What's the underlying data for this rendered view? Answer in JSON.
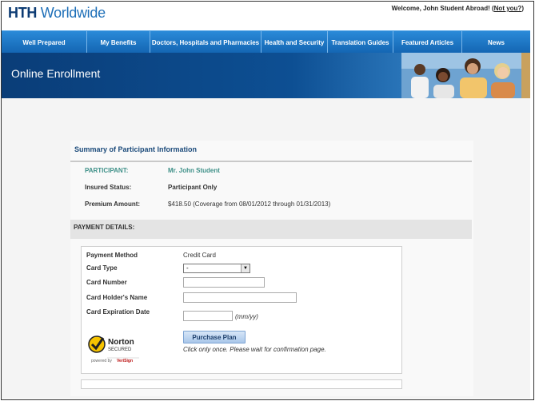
{
  "header": {
    "logo_bold": "HTH",
    "logo_light": "Worldwide",
    "welcome_text": "Welcome, John Student Abroad! (",
    "not_you_link": "Not you?",
    "welcome_close": ")"
  },
  "nav": {
    "items": [
      {
        "label": "Well Prepared"
      },
      {
        "label": "My Benefits"
      },
      {
        "label": "Doctors, Hospitals and Pharmacies"
      },
      {
        "label": "Health and Security"
      },
      {
        "label": "Translation Guides"
      },
      {
        "label": "Featured Articles"
      },
      {
        "label": "News"
      }
    ]
  },
  "banner": {
    "title": "Online Enrollment"
  },
  "summary": {
    "title": "Summary of Participant Information",
    "participant_label": "PARTICIPANT:",
    "participant_value": "Mr. John Student",
    "status_label": "Insured Status:",
    "status_value": "Participant Only",
    "premium_label": "Premium Amount:",
    "premium_value": "$418.50 (Coverage from 08/01/2012 through 01/31/2013)"
  },
  "payment": {
    "section_title": "PAYMENT DETAILS:",
    "method_label": "Payment Method",
    "method_value": "Credit Card",
    "card_type_label": "Card Type",
    "card_type_selected": "-",
    "card_number_label": "Card Number",
    "card_number_value": "",
    "holder_label": "Card Holder's Name",
    "holder_value": "",
    "expiry_label": "Card Expiration Date",
    "expiry_value": "",
    "expiry_hint": "(mm/yy)",
    "purchase_button": "Purchase Plan",
    "note": "Click only once. Please wait for confirmation page."
  },
  "norton_badge": {
    "brand": "Norton",
    "secured": "SECURED",
    "powered": "powered by",
    "verisign": "VeriSign"
  },
  "colors": {
    "nav_blue": "#1e78c8",
    "banner_navy": "#0a3d78",
    "teal_text": "#3e9088",
    "title_navy": "#1b4a7a"
  }
}
